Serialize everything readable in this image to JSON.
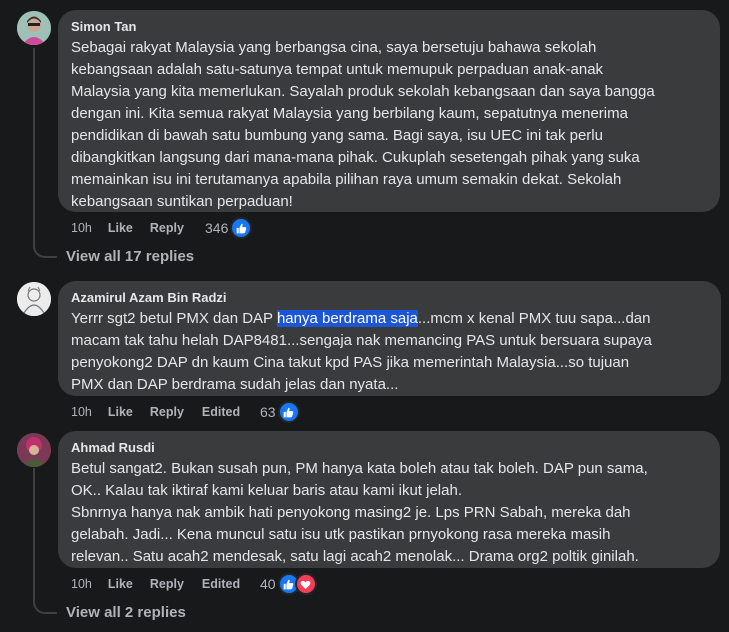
{
  "comments": [
    {
      "author": "Simon Tan",
      "text": "Sebagai rakyat Malaysia yang berbangsa cina, saya bersetuju bahawa sekolah\nkebangsaan adalah satu-satunya tempat untuk memupuk perpaduan anak-anak\nMalaysia yang kita memerlukan. Sayalah produk sekolah kebangsaan dan saya bangga\ndengan ini. Kita semua rakyat Malaysia yang berbilang kaum, sepatutnya menerima\npendidikan di bawah satu bumbung yang sama. Bagi saya, isu UEC ini tak perlu\ndibangkitkan langsung dari mana-mana pihak. Cukuplah sesetengah pihak yang suka\nmemainkan isu ini terutamanya apabila pilihan raya umum semakin dekat. Sekolah\nkebangsaan suntikan perpaduan!",
      "time": "10h",
      "like_label": "Like",
      "reply_label": "Reply",
      "reaction_count": "346",
      "view_replies": "View all 17 replies"
    },
    {
      "author": "Azamirul Azam Bin Radzi",
      "text_before": "Yerrr sgt2 betul PMX dan DAP ",
      "text_highlight": "hanya berdrama saja",
      "text_after": "...mcm x kenal PMX tuu sapa...dan\nmacam tak tahu helah DAP8481...sengaja nak memancing PAS untuk bersuara supaya\npenyokong2 DAP dn kaum Cina takut kpd PAS jika memerintah Malaysia...so tujuan\nPMX dan DAP berdrama sudah jelas dan nyata...",
      "time": "10h",
      "like_label": "Like",
      "reply_label": "Reply",
      "edited_label": "Edited",
      "reaction_count": "63"
    },
    {
      "author": "Ahmad Rusdi",
      "text": "Betul sangat2. Bukan susah pun, PM hanya kata boleh atau tak boleh. DAP pun sama,\nOK.. Kalau tak iktiraf kami keluar baris atau kami ikut jelah.\nSbnrnya hanya nak ambik hati penyokong masing2 je. Lps PRN Sabah, mereka dah\ngelabah. Jadi... Kena muncul satu isu utk pastikan prnyokong rasa mereka masih\nrelevan.. Satu acah2 mendesak, satu lagi acah2 menolak... Drama org2 poltik ginilah.",
      "time": "10h",
      "like_label": "Like",
      "reply_label": "Reply",
      "edited_label": "Edited",
      "reaction_count": "40",
      "view_replies": "View all 2 replies"
    }
  ],
  "colors": {
    "background": "#18191a",
    "bubble": "#3a3b3c",
    "like_blue": "#1877f2",
    "love_red": "#f33e58",
    "highlight": "#1c56d6"
  }
}
